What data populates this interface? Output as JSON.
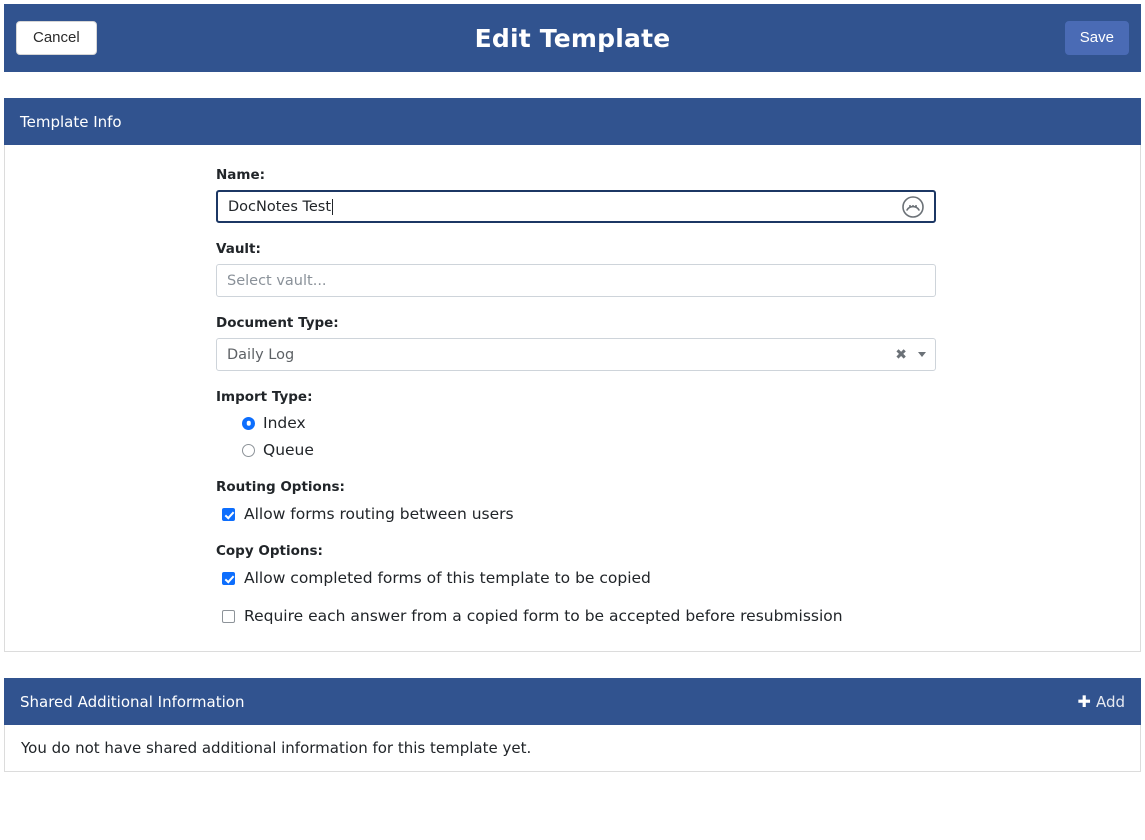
{
  "topbar": {
    "cancel_label": "Cancel",
    "title": "Edit Template",
    "save_label": "Save",
    "bg_color": "#31538F",
    "save_bg_color": "#4A6BB5"
  },
  "template_info": {
    "panel_title": "Template Info",
    "name": {
      "label": "Name:",
      "value": "DocNotes Test",
      "placeholder": "",
      "icon": "dictation-icon"
    },
    "vault": {
      "label": "Vault:",
      "value": "",
      "placeholder": "Select vault..."
    },
    "document_type": {
      "label": "Document Type:",
      "value": "Daily Log",
      "clear_icon": "clear-x-icon",
      "dropdown_icon": "chevron-down-icon"
    },
    "import_type": {
      "label": "Import Type:",
      "options": [
        {
          "label": "Index",
          "selected": true
        },
        {
          "label": "Queue",
          "selected": false
        }
      ]
    },
    "routing_options": {
      "label": "Routing Options:",
      "options": [
        {
          "label": "Allow forms routing between users",
          "checked": true
        }
      ]
    },
    "copy_options": {
      "label": "Copy Options:",
      "options": [
        {
          "label": "Allow completed forms of this template to be copied",
          "checked": true
        },
        {
          "label": "Require each answer from a copied form to be accepted before resubmission",
          "checked": false
        }
      ]
    }
  },
  "shared_additional_information": {
    "panel_title": "Shared Additional Information",
    "add_label": "Add",
    "add_plus": "✚",
    "empty_message": "You do not have shared additional information for this template yet."
  }
}
